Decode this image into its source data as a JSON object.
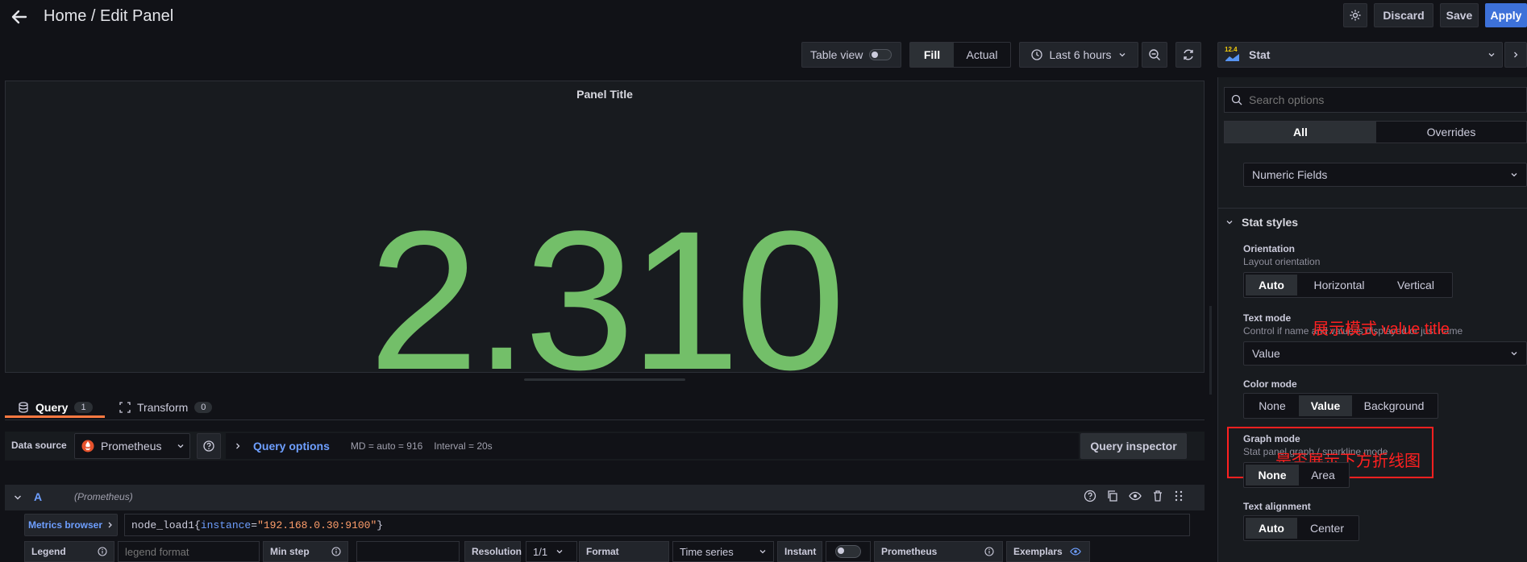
{
  "header": {
    "title": "Home / Edit Panel",
    "discard_label": "Discard",
    "save_label": "Save",
    "apply_label": "Apply"
  },
  "toolbar": {
    "table_view_label": "Table view",
    "fill_label": "Fill",
    "actual_label": "Actual",
    "time_range_label": "Last 6 hours",
    "visualization_label": "Stat",
    "visualization_version": "12.4"
  },
  "panel": {
    "title": "Panel Title",
    "value": "2.310",
    "value_color": "#73bf69"
  },
  "query_tabs": [
    {
      "label": "Query",
      "count": "1"
    },
    {
      "label": "Transform",
      "count": "0"
    }
  ],
  "query_editor": {
    "data_source_label": "Data source",
    "data_source_value": "Prometheus",
    "query_options_label": "Query options",
    "md_text": "MD = auto = 916",
    "interval_text": "Interval = 20s",
    "inspector_label": "Query inspector",
    "query_letter": "A",
    "query_source": "(Prometheus)",
    "metrics_browser_label": "Metrics browser",
    "expr_metric": "node_load1",
    "expr_label_key": "instance",
    "expr_label_value": "\"192.168.0.30:9100\"",
    "legend_label": "Legend",
    "legend_placeholder": "legend format",
    "min_step_label": "Min step",
    "resolution_label": "Resolution",
    "resolution_value": "1/1",
    "format_label": "Format",
    "format_value": "Time series",
    "instant_label": "Instant",
    "prometheus_label": "Prometheus",
    "exemplars_label": "Exemplars"
  },
  "options_pane": {
    "search_placeholder": "Search options",
    "tab_all": "All",
    "tab_overrides": "Overrides",
    "fields_value": "Numeric Fields",
    "section_title": "Stat styles",
    "orientation": {
      "title": "Orientation",
      "desc": "Layout orientation",
      "options": [
        "Auto",
        "Horizontal",
        "Vertical"
      ],
      "selected": "Auto"
    },
    "text_mode": {
      "title": "Text mode",
      "desc": "Control if name and value is displayed or just name",
      "value": "Value"
    },
    "color_mode": {
      "title": "Color mode",
      "options": [
        "None",
        "Value",
        "Background"
      ],
      "selected": "Value"
    },
    "graph_mode": {
      "title": "Graph mode",
      "desc": "Stat panel graph / sparkline mode",
      "options": [
        "None",
        "Area"
      ],
      "selected": "None"
    },
    "text_alignment": {
      "title": "Text alignment",
      "options": [
        "Auto",
        "Center"
      ],
      "selected": "Auto"
    }
  },
  "annotations": {
    "text_mode_note": "展示模式 value title",
    "graph_mode_note": "是否展示下方折线图",
    "color": "#ff2020"
  }
}
